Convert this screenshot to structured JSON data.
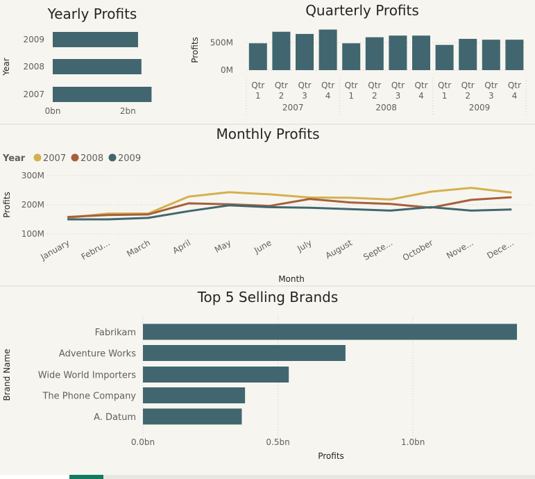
{
  "colors": {
    "bar": "#41666f",
    "y2007": "#d4b04e",
    "y2008": "#a85f3a",
    "y2009": "#41666f"
  },
  "chart_data": [
    {
      "id": "yearly",
      "type": "bar",
      "orientation": "horizontal",
      "title": "Yearly Profits",
      "ylabel": "Year",
      "categories": [
        "2009",
        "2008",
        "2007"
      ],
      "values": [
        2.27,
        2.36,
        2.63
      ],
      "ticks": [
        {
          "value": 0,
          "label": "0bn"
        },
        {
          "value": 2,
          "label": "2bn"
        }
      ],
      "xlim": [
        0,
        2.77
      ]
    },
    {
      "id": "quarterly",
      "type": "bar",
      "title": "Quarterly Profits",
      "ylabel": "Profits",
      "groups": [
        "2007",
        "2008",
        "2009"
      ],
      "quarter_labels": [
        "Qtr 1",
        "Qtr 2",
        "Qtr 3",
        "Qtr 4",
        "Qtr 1",
        "Qtr 2",
        "Qtr 3",
        "Qtr 4",
        "Qtr 1",
        "Qtr 2",
        "Qtr 3",
        "Qtr 4"
      ],
      "values": [
        490,
        700,
        660,
        740,
        490,
        600,
        630,
        630,
        460,
        570,
        555,
        555
      ],
      "ticks": [
        {
          "value": 0,
          "label": "0M"
        },
        {
          "value": 500,
          "label": "500M"
        }
      ],
      "ylim": [
        0,
        760
      ]
    },
    {
      "id": "monthly",
      "type": "line",
      "title": "Monthly Profits",
      "xlabel": "Month",
      "ylabel": "Profits",
      "legend_title": "Year",
      "categories": [
        "January",
        "Febru...",
        "March",
        "April",
        "May",
        "June",
        "July",
        "August",
        "Septe...",
        "October",
        "Nove...",
        "Dece..."
      ],
      "series": [
        {
          "name": "2007",
          "values": [
            155,
            170,
            170,
            228,
            243,
            236,
            225,
            224,
            218,
            245,
            258,
            242
          ]
        },
        {
          "name": "2008",
          "values": [
            158,
            165,
            167,
            205,
            202,
            196,
            220,
            208,
            203,
            190,
            217,
            226
          ]
        },
        {
          "name": "2009",
          "values": [
            150,
            150,
            155,
            178,
            198,
            192,
            190,
            185,
            180,
            192,
            180,
            184
          ]
        }
      ],
      "ticks": [
        {
          "value": 100,
          "label": "100M"
        },
        {
          "value": 200,
          "label": "200M"
        },
        {
          "value": 300,
          "label": "300M"
        }
      ],
      "ylim": [
        100,
        300
      ]
    },
    {
      "id": "brands",
      "type": "bar",
      "orientation": "horizontal",
      "title": "Top 5 Selling Brands",
      "xlabel": "Profits",
      "ylabel": "Brand Name",
      "categories": [
        "Fabrikam",
        "Adventure Works",
        "Wide World Importers",
        "The Phone Company",
        "A. Datum"
      ],
      "values": [
        1.385,
        0.75,
        0.54,
        0.378,
        0.366
      ],
      "ticks": [
        {
          "value": 0,
          "label": "0.0bn"
        },
        {
          "value": 0.5,
          "label": "0.5bn"
        },
        {
          "value": 1,
          "label": "1.0bn"
        }
      ],
      "xlim": [
        0,
        1.385
      ]
    }
  ]
}
